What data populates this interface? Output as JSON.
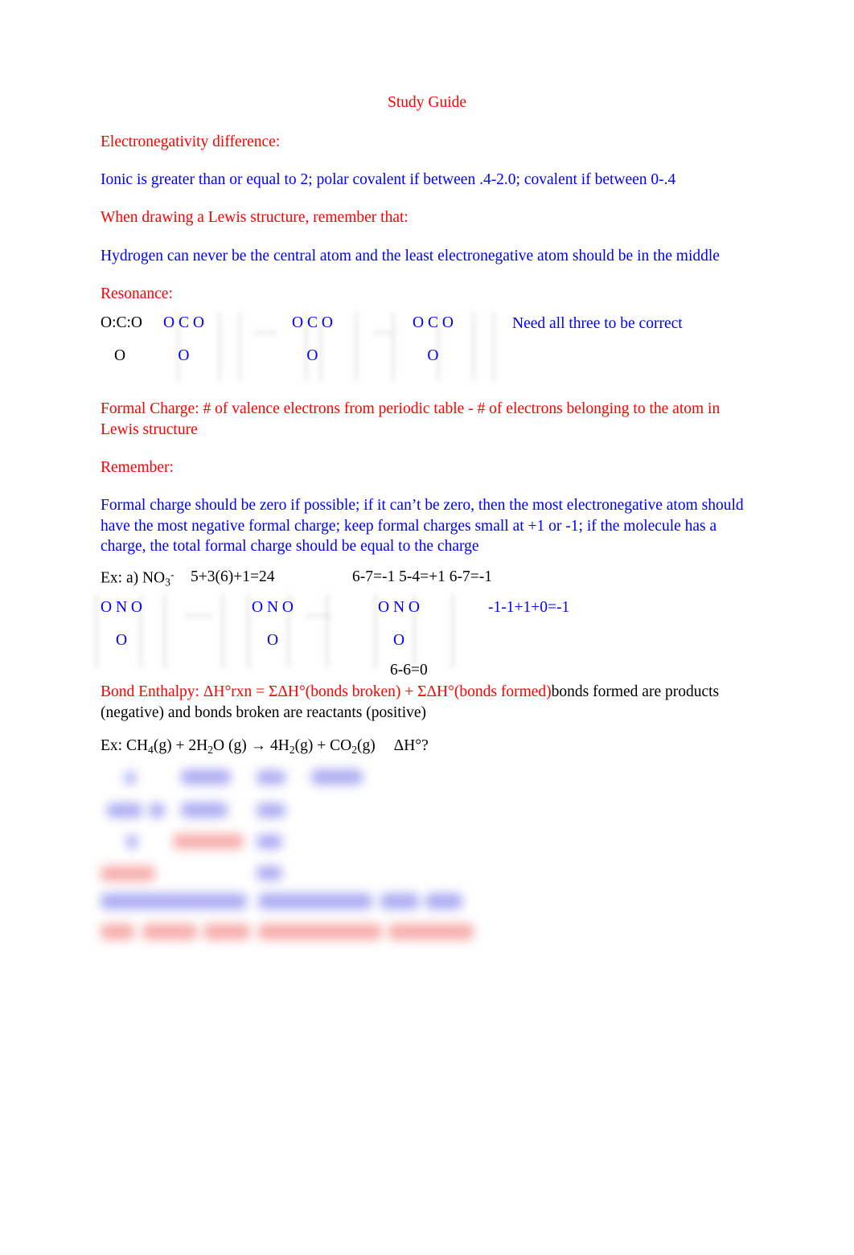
{
  "document": {
    "title": "Study Guide",
    "sections": {
      "electronegativity_heading": "Electronegativity difference:",
      "electronegativity_body": "Ionic is greater than or equal to 2; polar covalent if between .4-2.0; covalent if between 0-.4",
      "lewis_heading": "When drawing a Lewis structure, remember that:",
      "lewis_body": "Hydrogen can never be the central atom and the least electronegative atom should be in the middle",
      "resonance_heading": "Resonance:",
      "formal_charge_heading": "Formal Charge: # of valence electrons from periodic table - # of electrons belonging to the atom in Lewis structure",
      "remember_heading": "Remember:",
      "remember_body": "Formal charge should be zero if possible; if it can’t be zero, then the most electronegative atom should have the most negative formal charge; keep formal charges small at +1 or -1; if the molecule has a charge, the total formal charge should be equal to the charge"
    },
    "resonance": {
      "linear_top": "O:C:O",
      "linear_bottom": "O",
      "structure_top": "O  C  O",
      "structure_bottom": "O",
      "note": "Need all three to be correct"
    },
    "no3_example": {
      "label": "Ex: a) NO",
      "label_subscript": "3",
      "label_superscript": "-",
      "electron_count": "5+3(6)+1=24",
      "formal_charges_row": "6-7=-1    5-4=+1    6-7=-1",
      "structure_top": "O  N  O",
      "structure_bottom": "O",
      "sum_right": "-1-1+1+0=-1",
      "sum_bottom": "6-6=0"
    },
    "bond_enthalpy": {
      "heading_red": "Bond Enthalpy: ΔH°rxn = ΣΔH°(bonds broken) + ΣΔH°(bonds formed)",
      "heading_black": "bonds formed are products (negative) and bonds broken are reactants (positive)",
      "example_prefix": "Ex: CH",
      "example_full": "Ex: CH4(g) + 2H2O (g) → 4H2(g) + CO2(g)    ΔH°?",
      "eq_parts": {
        "p1": "Ex: CH",
        "s1": "4",
        "p2": "(g) + 2H",
        "s2": "2",
        "p3": "O (g) → 4H",
        "s3": "2",
        "p4": "(g) + CO",
        "s4": "2",
        "p5": "(g)",
        "p6": "ΔH°?"
      }
    },
    "redacted_note": "blurred illegible worked-solution table and two summary lines"
  },
  "colors": {
    "heading_red": "#ff0000",
    "body_blue": "#0000ff",
    "plain_black": "#000000",
    "page_background": "#ffffff"
  }
}
